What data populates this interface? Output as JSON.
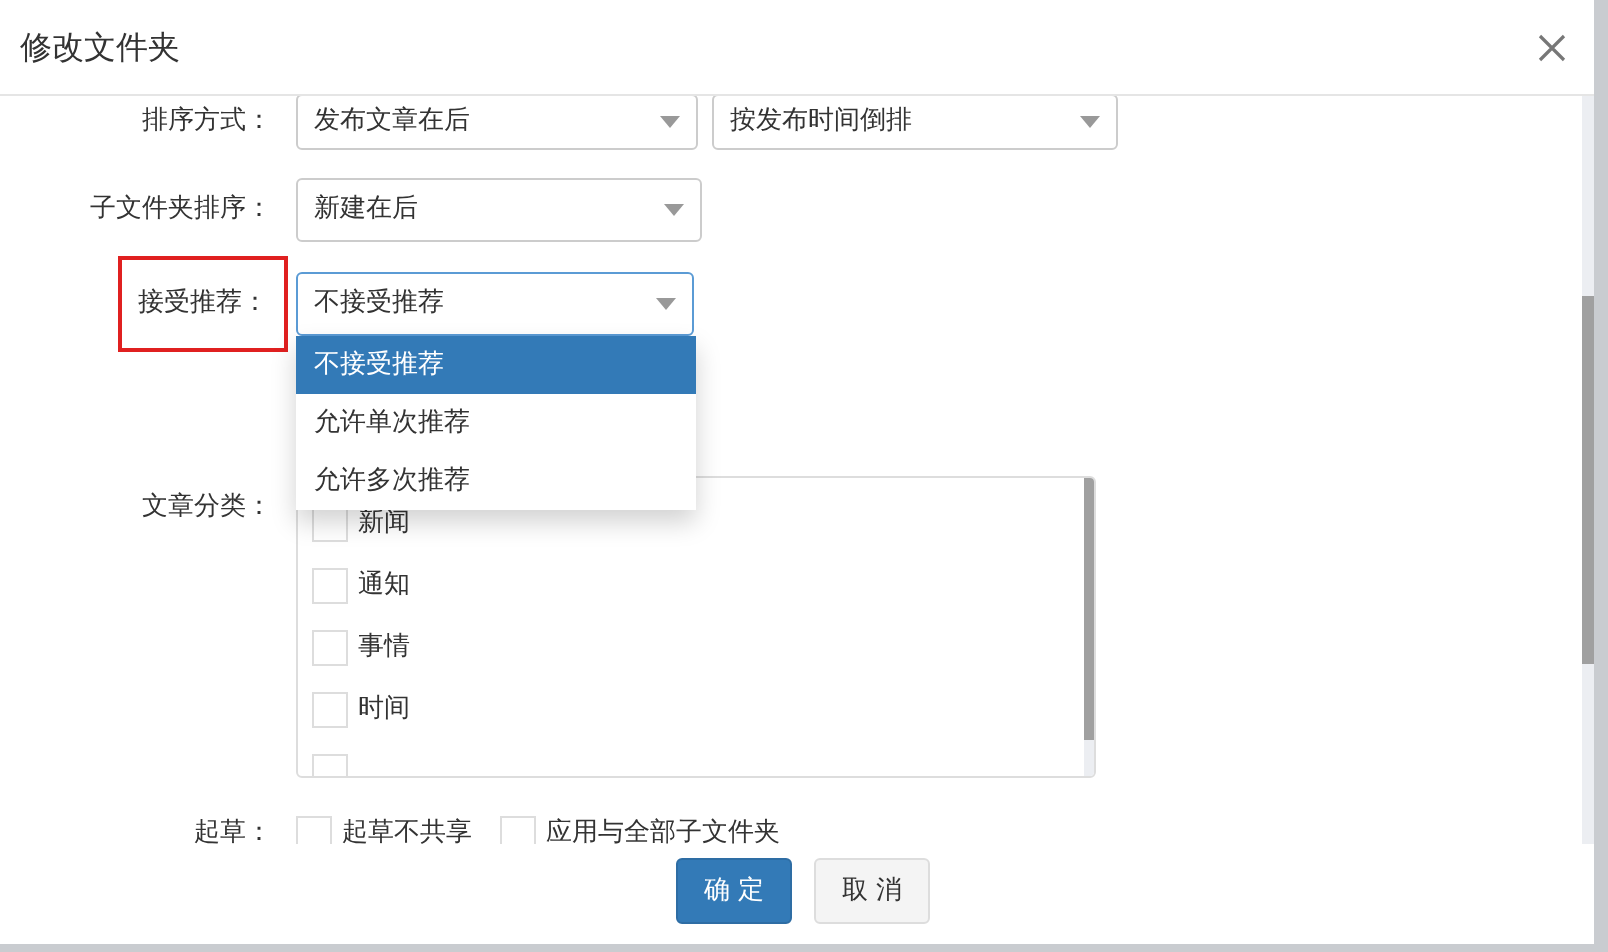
{
  "dialog": {
    "title": "修改文件夹"
  },
  "sort_order": {
    "label": "排序方式：",
    "values": [
      "发布文章在后",
      "按发布时间倒排"
    ]
  },
  "subfolder_sort": {
    "label": "子文件夹排序：",
    "value": "新建在后"
  },
  "accept_recommend": {
    "label": "接受推荐：",
    "highlighted": true,
    "value": "不接受推荐",
    "expanded": true,
    "options": [
      {
        "label": "不接受推荐",
        "selected": true
      },
      {
        "label": "允许单次推荐",
        "selected": false
      },
      {
        "label": "允许多次推荐",
        "selected": false
      }
    ]
  },
  "categories": {
    "label": "文章分类：",
    "items": [
      {
        "label": "新闻",
        "checked": false
      },
      {
        "label": "通知",
        "checked": false
      },
      {
        "label": "事情",
        "checked": false
      },
      {
        "label": "时间",
        "checked": false
      },
      {
        "checked": false
      }
    ]
  },
  "draft": {
    "label": "起草：",
    "options": [
      {
        "label": "起草不共享",
        "checked": false
      },
      {
        "label": "应用与全部子文件夹",
        "checked": false
      }
    ]
  },
  "buttons": [
    {
      "label": "确 定",
      "kind": "primary"
    },
    {
      "label": "取 消",
      "kind": "default"
    }
  ]
}
